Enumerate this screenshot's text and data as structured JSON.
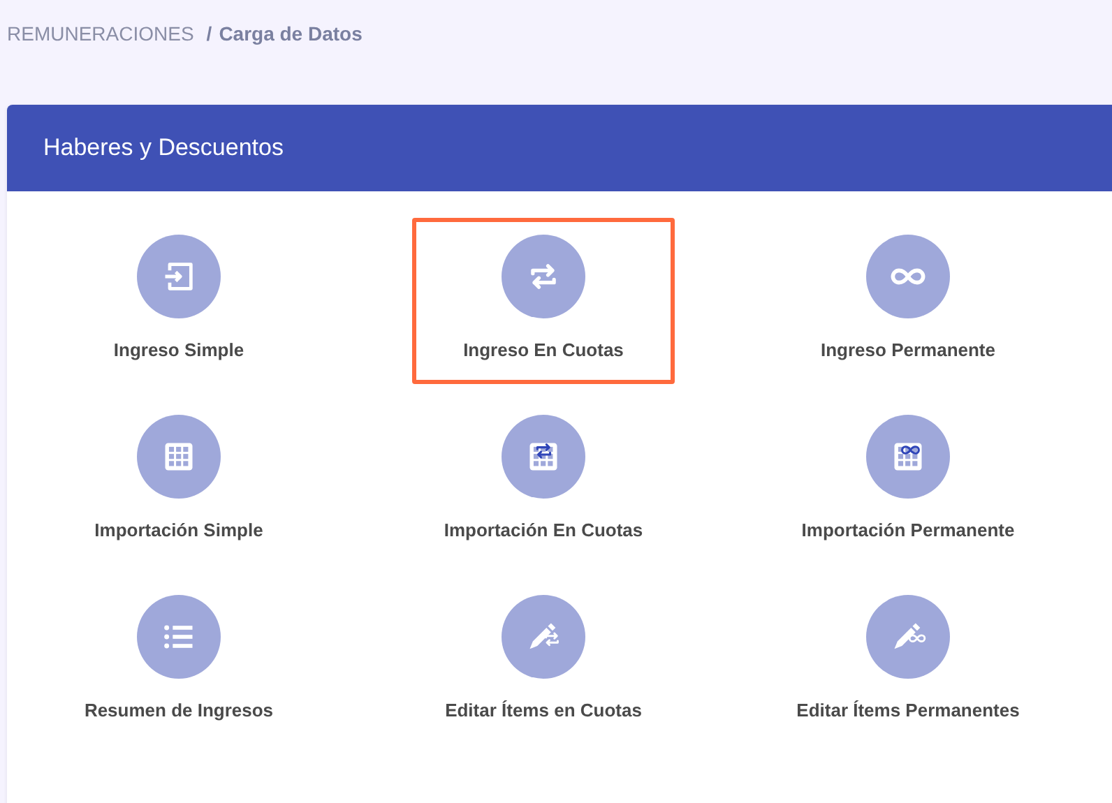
{
  "breadcrumb": {
    "parent": "REMUNERACIONES",
    "separator": "/",
    "current": "Carga de Datos"
  },
  "card": {
    "title": "Haberes y Descuentos",
    "items": [
      {
        "label": "Ingreso Simple",
        "kind": "enter",
        "selected": false
      },
      {
        "label": "Ingreso En Cuotas",
        "kind": "repeat",
        "selected": true
      },
      {
        "label": "Ingreso Permanente",
        "kind": "infinity",
        "selected": false
      },
      {
        "label": "Importación Simple",
        "kind": "grid",
        "selected": false
      },
      {
        "label": "Importación En Cuotas",
        "kind": "grid-repeat",
        "selected": false
      },
      {
        "label": "Importación Permanente",
        "kind": "grid-infinity",
        "selected": false
      },
      {
        "label": "Resumen de Ingresos",
        "kind": "list",
        "selected": false
      },
      {
        "label": "Editar Ítems en Cuotas",
        "kind": "edit-repeat",
        "selected": false
      },
      {
        "label": "Editar Ítems Permanentes",
        "kind": "edit-infinity",
        "selected": false
      }
    ]
  }
}
